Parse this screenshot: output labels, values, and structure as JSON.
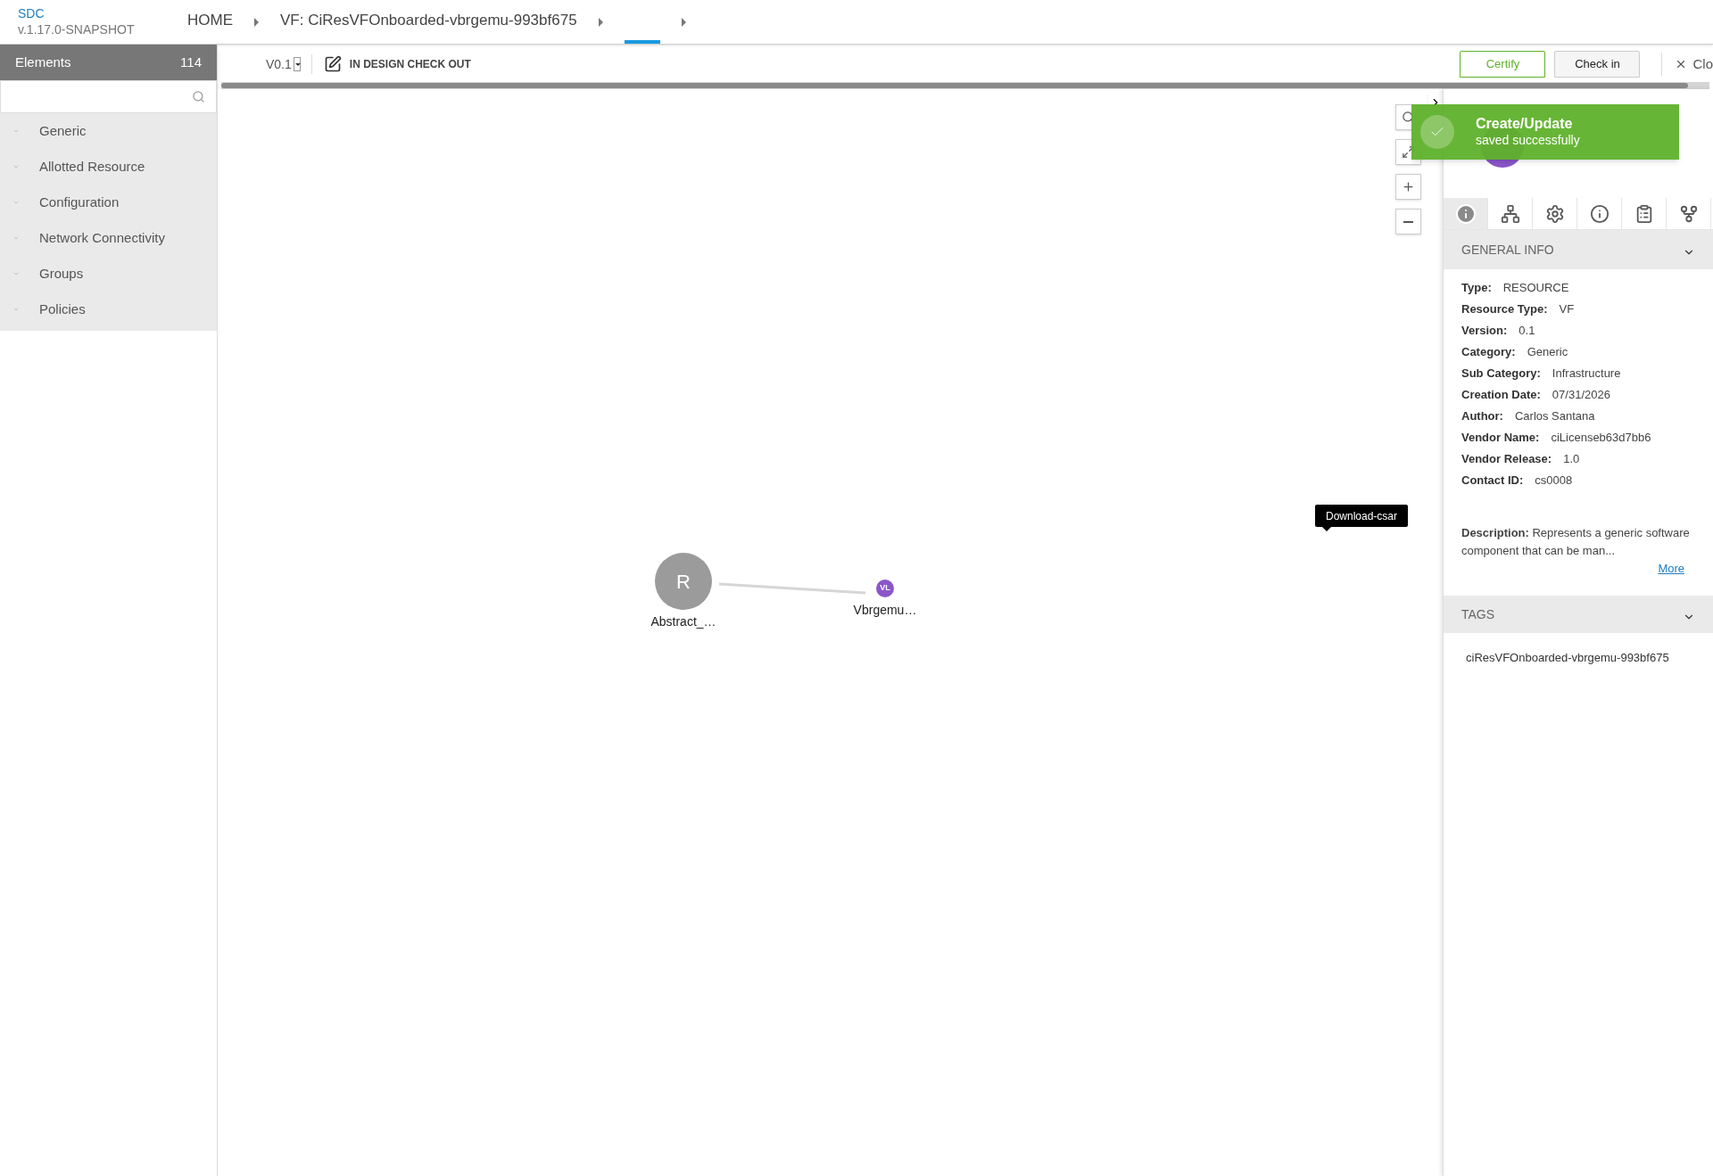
{
  "app": {
    "name": "SDC",
    "version": "v.1.17.0-SNAPSHOT"
  },
  "breadcrumbs": [
    {
      "label": "HOME",
      "selected": false
    },
    {
      "label": "VF: CiResVFOnboarded-vbrgemu-993bf675",
      "selected": false
    },
    {
      "selected": true
    }
  ],
  "palette": {
    "title": "Elements",
    "count": "114",
    "groups": [
      "Generic",
      "Allotted Resource",
      "Configuration",
      "Network Connectivity",
      "Groups",
      "Policies"
    ]
  },
  "toolbar": {
    "version": "V0.1",
    "status": "IN DESIGN CHECK OUT",
    "buttons": [
      {
        "label": "Certify",
        "kind": "primary"
      },
      {
        "label": "Check in",
        "kind": "secondary"
      }
    ],
    "close": "Clo"
  },
  "canvas": {
    "nodes": [
      {
        "kind": "resource",
        "letter": "R",
        "label": "Abstract_…"
      },
      {
        "kind": "vl",
        "letter": "VL",
        "label": "Vbrgemu…"
      }
    ],
    "tooltip": "Download-csar"
  },
  "toast": {
    "title": "Create/Update",
    "message": "saved successfully"
  },
  "panel_tabs": [
    {
      "kind": "info",
      "selected": true
    },
    {
      "kind": "composition",
      "selected": false
    },
    {
      "kind": "settings",
      "selected": false
    },
    {
      "kind": "details",
      "selected": false
    },
    {
      "kind": "clipboard",
      "selected": false
    },
    {
      "kind": "paths",
      "selected": false
    }
  ],
  "general_info": {
    "title": "GENERAL INFO",
    "fields": [
      {
        "label": "Type:",
        "value": "RESOURCE"
      },
      {
        "label": "Resource Type:",
        "value": "VF"
      },
      {
        "label": "Version:",
        "value": "0.1"
      },
      {
        "label": "Category:",
        "value": "Generic"
      },
      {
        "label": "Sub Category:",
        "value": "Infrastructure"
      },
      {
        "label": "Creation Date:",
        "value": "07/31/2026"
      },
      {
        "label": "Author:",
        "value": "Carlos Santana"
      },
      {
        "label": "Vendor Name:",
        "value": "ciLicenseb63d7bb6"
      },
      {
        "label": "Vendor Release:",
        "value": "1.0"
      },
      {
        "label": "Contact ID:",
        "value": "cs0008"
      }
    ],
    "description": "**Description:** Represents a generic software component that can be man...",
    "more": "More"
  },
  "tags": {
    "title": "TAGS",
    "items": [
      "ciResVFOnboarded-vbrgemu-993bf675"
    ]
  }
}
